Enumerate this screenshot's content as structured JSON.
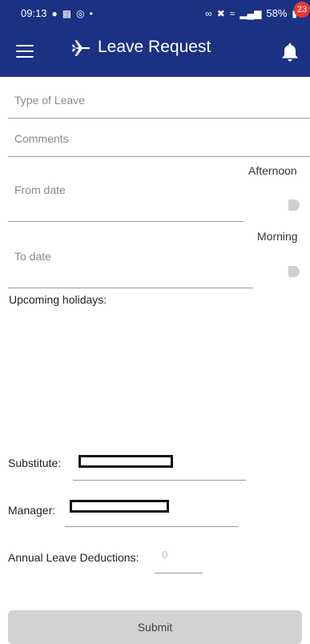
{
  "status_bar": {
    "time": "09:13",
    "battery": "58%"
  },
  "app_bar": {
    "title": "Leave Request",
    "notification_count": "23",
    "menu_icon": "hamburger-icon",
    "title_icon": "airplane-icon",
    "notification_icon": "bell-icon"
  },
  "form": {
    "type_of_leave_placeholder": "Type of Leave",
    "comments_placeholder": "Comments",
    "from_date_placeholder": "From date",
    "from_date_period_label": "Afternoon",
    "to_date_placeholder": "To date",
    "to_date_period_label": "Morning",
    "upcoming_holidays_label": "Upcoming holidays:",
    "substitute_label": "Substitute:",
    "manager_label": "Manager:",
    "annual_leave_deductions_label": "Annual Leave Deductions:",
    "annual_leave_deductions_value": "0"
  },
  "actions": {
    "submit_label": "Submit"
  },
  "colors": {
    "header_bg": "#1b3282",
    "badge_bg": "#e53935",
    "submit_bg": "#d2d2d2"
  }
}
